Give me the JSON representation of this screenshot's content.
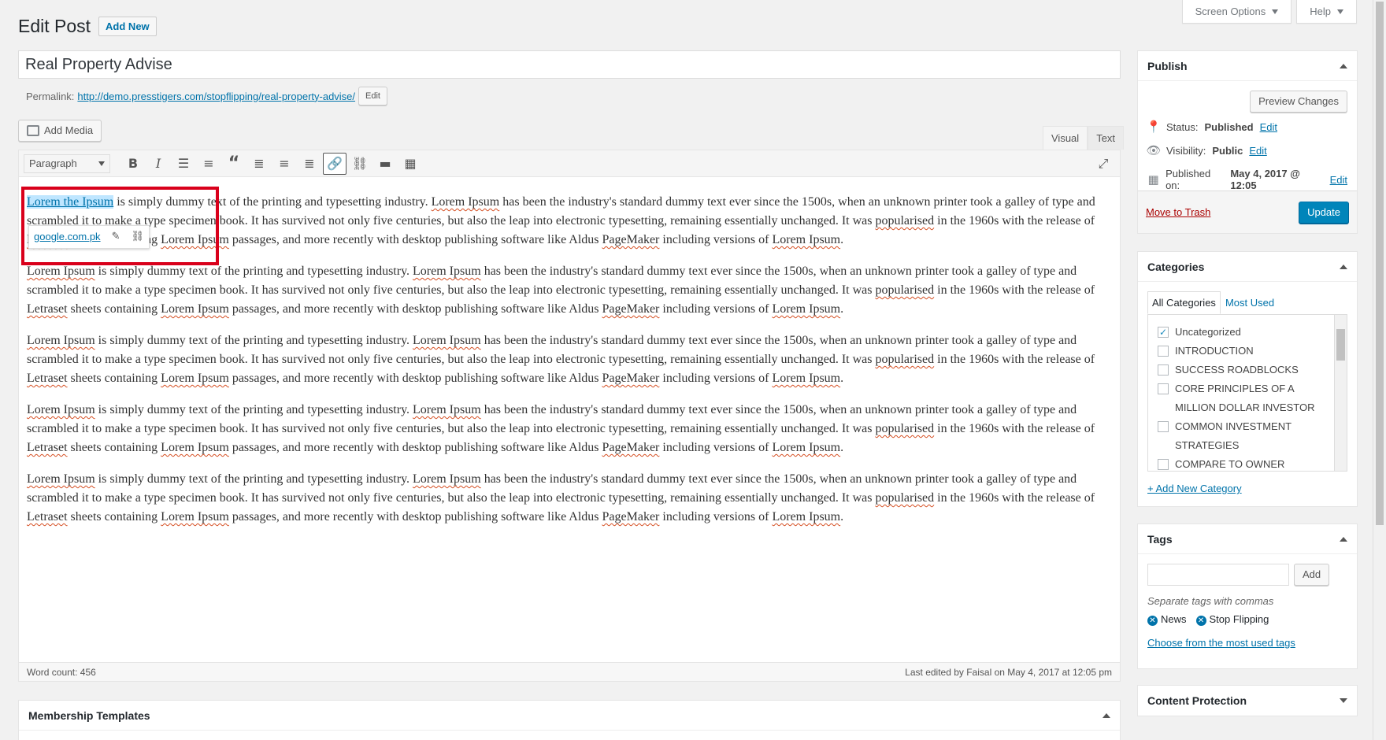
{
  "header": {
    "title": "Edit Post",
    "add_new": "Add New",
    "screen_options": "Screen Options",
    "help": "Help"
  },
  "post": {
    "title": "Real Property Advise",
    "permalink_label": "Permalink:",
    "permalink_url": "http://demo.presstigers.com/stopflipping/real-property-advise/",
    "permalink_edit": "Edit"
  },
  "editor": {
    "add_media": "Add Media",
    "tab_visual": "Visual",
    "tab_text": "Text",
    "format": "Paragraph",
    "link_text": "Lorem the Ipsum",
    "link_popup_url": "google.com.pk",
    "word_count": "Word count: 456",
    "last_edited": "Last edited by Faisal on May 4, 2017 at 12:05 pm"
  },
  "paragraph_first_rest": " is simply dummy text of the printing and typesetting industry. ",
  "paragraph_parts": {
    "lorem_ipsum": "Lorem Ipsum",
    "p1": " is simply dummy text of the printing and typesetting industry. ",
    "p2": " has been the industry's standard dummy text ever since the 1500s, when an unknown printer took a galley of type and scrambled it to make a type specimen book. It has survived not only five centuries, but also the leap into electronic typesetting, remaining essentially unchanged. It was ",
    "popularised": "popularised",
    "p3": " in the 1960s with the release of ",
    "letraset": "Letraset",
    "p4": " sheets containing ",
    "p5": " passages, and more recently with desktop publishing software like Aldus ",
    "pagemaker": "PageMaker",
    "p6": " including versions of ",
    "end": "."
  },
  "membership": {
    "title": "Membership Templates"
  },
  "publish": {
    "title": "Publish",
    "preview": "Preview Changes",
    "status_label": "Status: ",
    "status_value": "Published",
    "visibility_label": "Visibility: ",
    "visibility_value": "Public",
    "published_label": "Published on: ",
    "published_value": "May 4, 2017 @ 12:05",
    "edit": "Edit",
    "trash": "Move to Trash",
    "update": "Update"
  },
  "categories": {
    "title": "Categories",
    "tab_all": "All Categories",
    "tab_used": "Most Used",
    "items": [
      {
        "label": "Uncategorized",
        "checked": true
      },
      {
        "label": "INTRODUCTION",
        "checked": false
      },
      {
        "label": "SUCCESS ROADBLOCKS",
        "checked": false
      },
      {
        "label": "CORE PRINCIPLES OF A MILLION DOLLAR INVESTOR",
        "checked": false
      },
      {
        "label": "COMMON INVESTMENT STRATEGIES",
        "checked": false
      },
      {
        "label": "COMPARE TO OWNER FINANCE",
        "checked": false
      }
    ],
    "add_new": "+ Add New Category"
  },
  "tags": {
    "title": "Tags",
    "add": "Add",
    "hint": "Separate tags with commas",
    "items": [
      "News",
      "Stop Flipping"
    ],
    "choose": "Choose from the most used tags"
  },
  "content_protection": {
    "title": "Content Protection"
  },
  "colors": {
    "accent": "#0073aa",
    "primary_button": "#0085ba",
    "highlight_border": "#d9001b"
  },
  "icons": [
    "checkmark-icon",
    "pin-icon",
    "eye-icon",
    "calendar-icon",
    "bold-icon",
    "italic-icon",
    "link-icon",
    "unlink-icon"
  ]
}
